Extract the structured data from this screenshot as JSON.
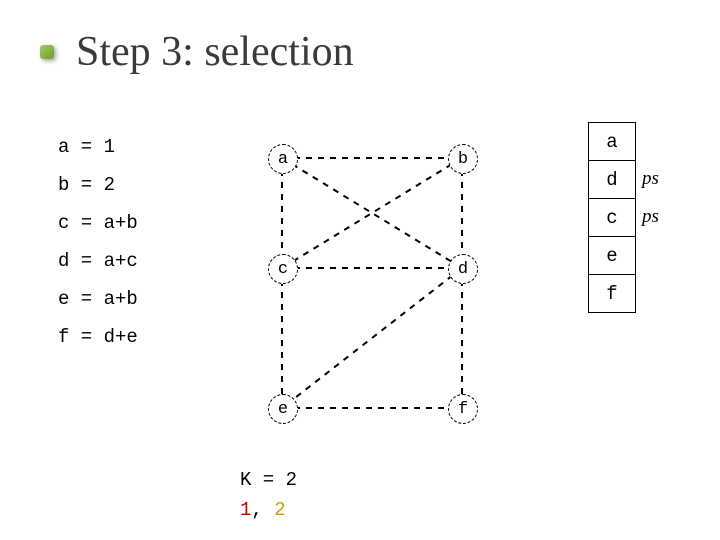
{
  "title": "Step 3: selection",
  "equations": {
    "a": "a = 1",
    "b": "b = 2",
    "c": "c = a+b",
    "d": "d = a+c",
    "e": "e = a+b",
    "f": "f = d+e"
  },
  "graph": {
    "nodes": {
      "a": "a",
      "b": "b",
      "c": "c",
      "d": "d",
      "e": "e",
      "f": "f"
    }
  },
  "stack": {
    "a": "a",
    "d": "d",
    "c": "c",
    "e": "e",
    "f": "f"
  },
  "ps": {
    "d": "ps",
    "c": "ps"
  },
  "footer": {
    "k": "K = 2",
    "one": "1",
    "comma": ", ",
    "two": "2"
  }
}
